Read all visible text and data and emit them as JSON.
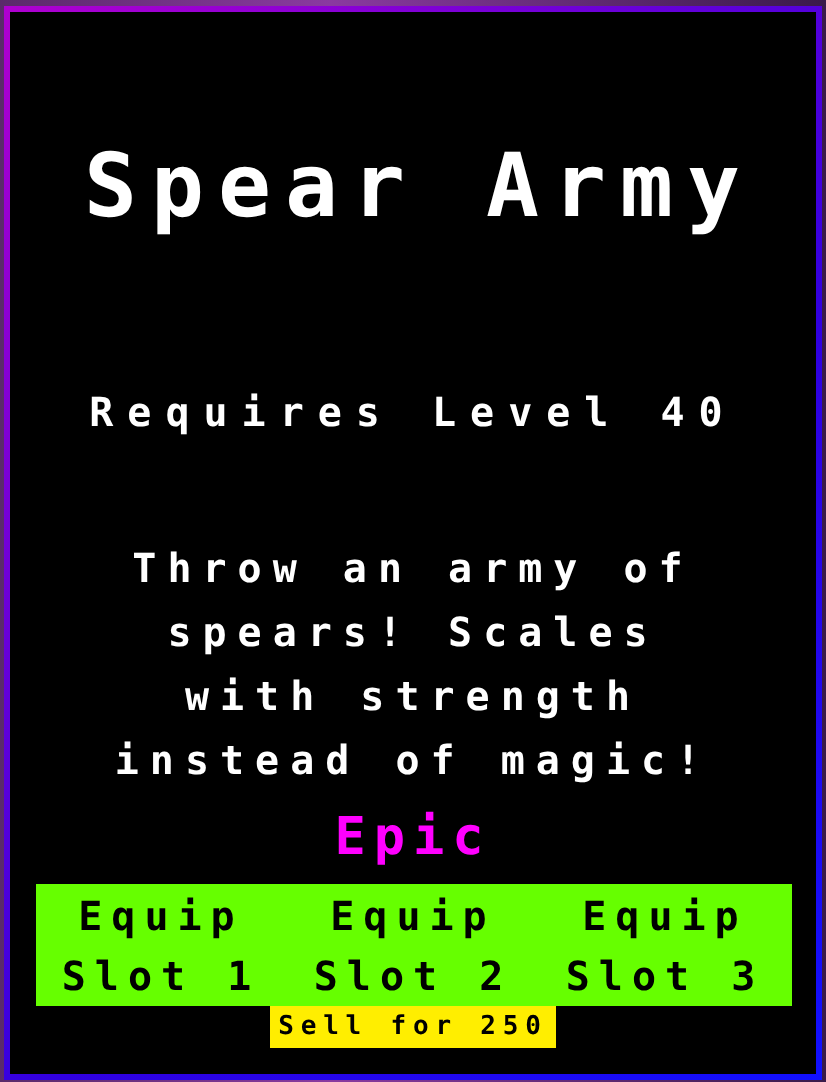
{
  "title": "Spear Army",
  "requirement": "Requires Level 40",
  "description": "Throw an army of spears! Scales with strength instead of magic!",
  "rarity": {
    "label": "Epic",
    "color": "#ff00ff"
  },
  "equip_buttons": [
    "Equip Slot 1",
    "Equip Slot 2",
    "Equip Slot 3"
  ],
  "sell_button": "Sell for 250"
}
